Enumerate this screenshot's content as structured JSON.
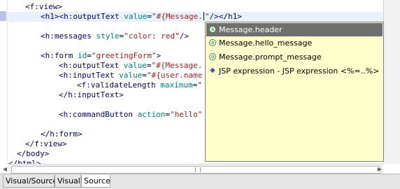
{
  "editor": {
    "lines": [
      {
        "parts": [
          {
            "c": "tag",
            "t": "<f:view>"
          }
        ]
      },
      {
        "current": true,
        "parts": [
          {
            "c": "tag",
            "t": "<h1><h:outputText "
          },
          {
            "c": "attr",
            "t": "value"
          },
          {
            "c": "txt",
            "t": "="
          },
          {
            "c": "str",
            "t": "\"#{Message."
          },
          {
            "c": "caret",
            "t": ""
          },
          {
            "c": "str",
            "t": "\""
          },
          {
            "c": "tag",
            "t": "/></h1>"
          }
        ]
      },
      {
        "parts": []
      },
      {
        "parts": [
          {
            "c": "tag",
            "t": "<h:messages "
          },
          {
            "c": "attr",
            "t": "style"
          },
          {
            "c": "txt",
            "t": "="
          },
          {
            "c": "str",
            "t": "\"color: red\""
          },
          {
            "c": "tag",
            "t": "/>"
          }
        ]
      },
      {
        "parts": []
      },
      {
        "parts": [
          {
            "c": "tag",
            "t": "<h:form "
          },
          {
            "c": "attr",
            "t": "id"
          },
          {
            "c": "txt",
            "t": "="
          },
          {
            "c": "str",
            "t": "\"greetingForm\""
          },
          {
            "c": "tag",
            "t": ">"
          }
        ]
      },
      {
        "parts": [
          {
            "c": "tag",
            "t": "<h:outputText "
          },
          {
            "c": "attr",
            "t": "value"
          },
          {
            "c": "txt",
            "t": "="
          },
          {
            "c": "str",
            "t": "\"#{Message."
          }
        ]
      },
      {
        "parts": [
          {
            "c": "tag",
            "t": "<h:inputText "
          },
          {
            "c": "attr",
            "t": "value"
          },
          {
            "c": "txt",
            "t": "="
          },
          {
            "c": "str",
            "t": "\"#{user.name"
          }
        ]
      },
      {
        "parts": [
          {
            "c": "tag",
            "t": "<f:validateLength "
          },
          {
            "c": "attr",
            "t": "maximum"
          },
          {
            "c": "txt",
            "t": "="
          },
          {
            "c": "str",
            "t": "\""
          }
        ]
      },
      {
        "parts": [
          {
            "c": "tag",
            "t": "</h:inputText>"
          }
        ]
      },
      {
        "parts": []
      },
      {
        "parts": [
          {
            "c": "tag",
            "t": "<h:commandButton "
          },
          {
            "c": "attr",
            "t": "action"
          },
          {
            "c": "txt",
            "t": "="
          },
          {
            "c": "str",
            "t": "\"hello\""
          }
        ]
      },
      {
        "parts": []
      },
      {
        "parts": [
          {
            "c": "tag",
            "t": "</h:form>"
          }
        ]
      },
      {
        "parts": [
          {
            "c": "tag",
            "t": "</f:view>"
          }
        ]
      },
      {
        "parts": [
          {
            "c": "tag",
            "t": "</body>"
          }
        ]
      },
      {
        "parts": [
          {
            "c": "tag",
            "t": "</html>"
          }
        ]
      }
    ]
  },
  "completion": {
    "items": [
      {
        "label": "Message.header",
        "icon": "attribute-icon",
        "glyph": "a",
        "selected": true
      },
      {
        "label": "Message.hello_message",
        "icon": "attribute-icon",
        "glyph": "a",
        "selected": false
      },
      {
        "label": "Message.prompt_message",
        "icon": "attribute-icon",
        "glyph": "a",
        "selected": false
      },
      {
        "label": "JSP expression - JSP expression <%=..%>",
        "icon": "jsp-diamond-icon",
        "glyph": "◆",
        "selected": false
      }
    ]
  },
  "tabs": [
    {
      "label": "Visual/Source",
      "active": false
    },
    {
      "label": "Visual",
      "active": false
    },
    {
      "label": "Source",
      "active": true
    }
  ],
  "colors": {
    "tag": "#000080",
    "attribute": "#008080",
    "string": "#b02020",
    "selection": "#6f6f6f",
    "popup_bg": "#ffffcc"
  }
}
